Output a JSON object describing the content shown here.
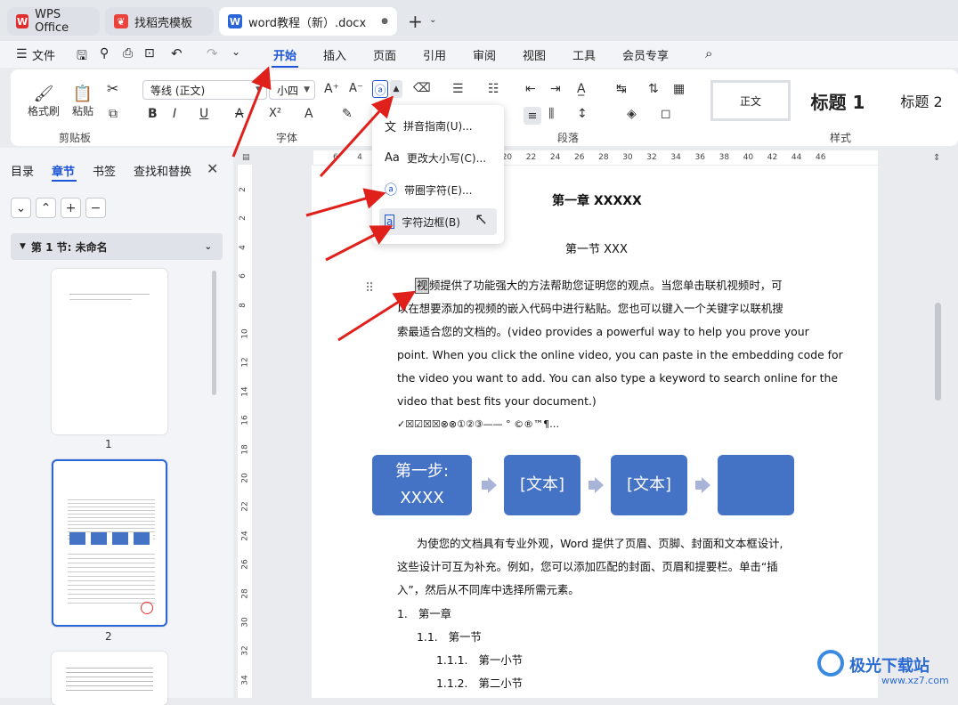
{
  "tabs": [
    {
      "label": "WPS Office",
      "icon": "wps-logo-icon"
    },
    {
      "label": "找稻壳模板",
      "icon": "docer-logo-icon"
    },
    {
      "label": "word教程（新）.docx",
      "icon": "word-doc-icon"
    }
  ],
  "menu": {
    "file": "文件",
    "items": [
      "开始",
      "插入",
      "页面",
      "引用",
      "审阅",
      "视图",
      "工具",
      "会员专享"
    ],
    "selected": "开始"
  },
  "ribbon": {
    "clipboard": {
      "format_painter": "格式刷",
      "paste": "粘贴",
      "label": "剪贴板"
    },
    "font": {
      "name": "等线 (正文)",
      "size": "小四",
      "label": "字体"
    },
    "paragraph": {
      "label": "段落"
    },
    "styles": {
      "normal": "正文",
      "h1": "标题 1",
      "h2": "标题 2",
      "label": "样式"
    }
  },
  "dropdown": {
    "items": [
      {
        "label": "拼音指南(U)...",
        "icon": "pinyin-icon"
      },
      {
        "label": "更改大小写(C)...",
        "icon": "change-case-icon"
      },
      {
        "label": "带圈字符(E)...",
        "icon": "enclosed-char-icon"
      },
      {
        "label": "字符边框(B)",
        "icon": "char-border-icon"
      }
    ],
    "hovered_index": 3
  },
  "sidebar": {
    "tabs": [
      "目录",
      "章节",
      "书签",
      "查找和替换"
    ],
    "selected_tab": "章节",
    "section_title": "第 1 节: 未命名",
    "pages": [
      "1",
      "2"
    ]
  },
  "ruler": {
    "h_ticks": [
      "6",
      "4",
      "10",
      "12",
      "14",
      "16",
      "18",
      "20",
      "22",
      "24",
      "26",
      "28",
      "30",
      "32",
      "34",
      "36",
      "38",
      "40",
      "42",
      "44",
      "46"
    ],
    "v_ticks": [
      "2",
      "2",
      "4",
      "6",
      "8",
      "10",
      "12",
      "14",
      "16",
      "18",
      "20",
      "22",
      "24",
      "26",
      "28",
      "30",
      "32",
      "34"
    ]
  },
  "document": {
    "heading1": "第一章  XXXXX",
    "heading2": "第一节  XXX",
    "para1_lines": [
      "频提供了功能强大的方法帮助您证明您的观点。当您单击联机视频时，可",
      "以在想要添加的视频的嵌入代码中进行粘贴。您也可以键入一个关键字以联机搜",
      "索最适合您的文档的。(video provides a powerful way to help you prove your",
      "point. When you click the online video, you can paste in the embedding code for",
      "the video you want to add. You can also type a keyword to search online for the",
      "video that best fits your document.)"
    ],
    "para1_first_char": "视",
    "symbols_line": "✓☒☑☒☒⊗⊗①②③——  °  ©®™¶…",
    "flow": [
      "第一步:\nXXXX",
      "[文本]",
      "[文本]",
      ""
    ],
    "para2_lines": [
      "为使您的文档具有专业外观，Word 提供了页眉、页脚、封面和文本框设计,",
      "这些设计可互为补充。例如，您可以添加匹配的封面、页眉和提要栏。单击“插",
      "入”，然后从不同库中选择所需元素。"
    ],
    "list": [
      {
        "num": "1.",
        "text": "第一章"
      },
      {
        "num": "1.1.",
        "text": "第一节"
      },
      {
        "num": "1.1.1.",
        "text": "第一小节"
      },
      {
        "num": "1.1.2.",
        "text": "第二小节"
      }
    ]
  },
  "watermark": {
    "name": "极光下载站",
    "url": "www.xz7.com"
  },
  "colors": {
    "accent": "#1d55d6",
    "flow_box": "#4472c4",
    "annotation_arrow": "#e0201b"
  }
}
